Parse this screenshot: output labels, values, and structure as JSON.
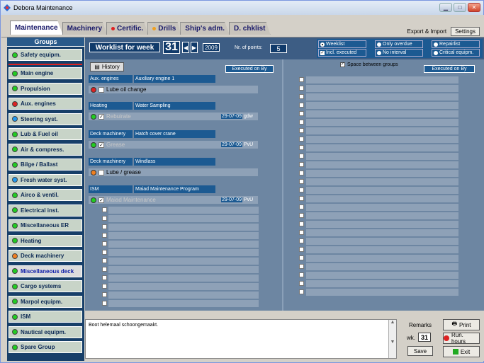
{
  "window": {
    "title": "Debora Maintenance"
  },
  "tabs": [
    {
      "label": "Maintenance",
      "active": true
    },
    {
      "label": "Machinery"
    },
    {
      "label": "Certific.",
      "dot": "#e02020"
    },
    {
      "label": "Drills",
      "dot": "#f0a020"
    },
    {
      "label": "Ship's adm."
    },
    {
      "label": "D. chklist"
    }
  ],
  "topright": {
    "export_label": "Export & Import",
    "settings_label": "Settings"
  },
  "groups": {
    "title": "Groups",
    "items": [
      {
        "label": "Safety equipm.",
        "dot": "#22cc22"
      },
      {
        "label": "Main engine",
        "dot": "#22cc22"
      },
      {
        "label": "Propulsion",
        "dot": "#22cc22"
      },
      {
        "label": "Aux. engines",
        "dot": "#dd2222"
      },
      {
        "label": "Steering syst.",
        "dot": "#2299ee"
      },
      {
        "label": "Lub & Fuel oil",
        "dot": "#22cc22"
      },
      {
        "label": "Air & compress.",
        "dot": "#22cc22"
      },
      {
        "label": "Bilge / Ballast",
        "dot": "#22cc22"
      },
      {
        "label": "Fresh water syst.",
        "dot": "#2299ee"
      },
      {
        "label": "Airco & ventil.",
        "dot": "#22cc22"
      },
      {
        "label": "Electrical inst.",
        "dot": "#22cc22"
      },
      {
        "label": "Miscellaneous ER",
        "dot": "#22cc22"
      },
      {
        "label": "Heating",
        "dot": "#22cc22"
      },
      {
        "label": "Deck machinery",
        "dot": "#f08020"
      },
      {
        "label": "Miscellaneous deck",
        "dot": "#22cc22",
        "selected": true
      },
      {
        "label": "Cargo systems",
        "dot": "#22cc22"
      },
      {
        "label": "Marpol equipm.",
        "dot": "#22cc22"
      },
      {
        "label": "ISM",
        "dot": "#22cc22"
      },
      {
        "label": "Nautical equipm.",
        "dot": "#22cc22"
      },
      {
        "label": "Spare Group",
        "dot": "#22cc22"
      }
    ]
  },
  "toolbar": {
    "worklist_label": "Worklist for week",
    "week": "31",
    "year": "2009",
    "nr_points_label": "Nr. of points:",
    "nr_points": "5"
  },
  "options": [
    {
      "label": "Weeklist",
      "kind": "radio",
      "on": true
    },
    {
      "label": "Only overdue",
      "kind": "radio"
    },
    {
      "label": "Repairlist",
      "kind": "radio"
    },
    {
      "label": "Incl. executed",
      "kind": "check",
      "on": true
    },
    {
      "label": "No interval",
      "kind": "radio"
    },
    {
      "label": "Critical equipm.",
      "kind": "radio"
    }
  ],
  "left": {
    "history_label": "History",
    "executed_header": "Executed on   By",
    "groups": [
      {
        "group": "Aux. engines",
        "item": "Auxiliary engine 1",
        "task": "Lube oil change",
        "dot": "#dd2222",
        "checked": false,
        "date": "",
        "by": ""
      },
      {
        "group": "Heating",
        "item": "Water Sampling",
        "task": "Rebuirate",
        "dot": "#22cc22",
        "checked": true,
        "date": "29-07-09",
        "by": "gdw"
      },
      {
        "group": "Deck machinery",
        "item": "Hatch cover crane",
        "task": "Grease",
        "dot": "#22cc22",
        "checked": true,
        "date": "29-07-09",
        "by": "PvU"
      },
      {
        "group": "Deck machinery",
        "item": "Windlass",
        "task": "Lube / grease",
        "dot": "#f08020",
        "checked": false,
        "date": "",
        "by": ""
      },
      {
        "group": "ISM",
        "item": "Maiad Maintenance Program",
        "task": "Maiad Maintenance",
        "dot": "#22cc22",
        "checked": true,
        "date": "29-07-09",
        "by": "PvU"
      }
    ]
  },
  "right": {
    "space_label": "Space between groups",
    "executed_header": "Executed on   By"
  },
  "bottom": {
    "remarks_text": "Boot helemaal schoongemaakt.",
    "remarks_label": "Remarks",
    "wk_label": "wk.",
    "wk_value": "31",
    "save_label": "Save",
    "print_label": "Print",
    "run_hours_label": "Run. hours",
    "exit_label": "Exit"
  }
}
